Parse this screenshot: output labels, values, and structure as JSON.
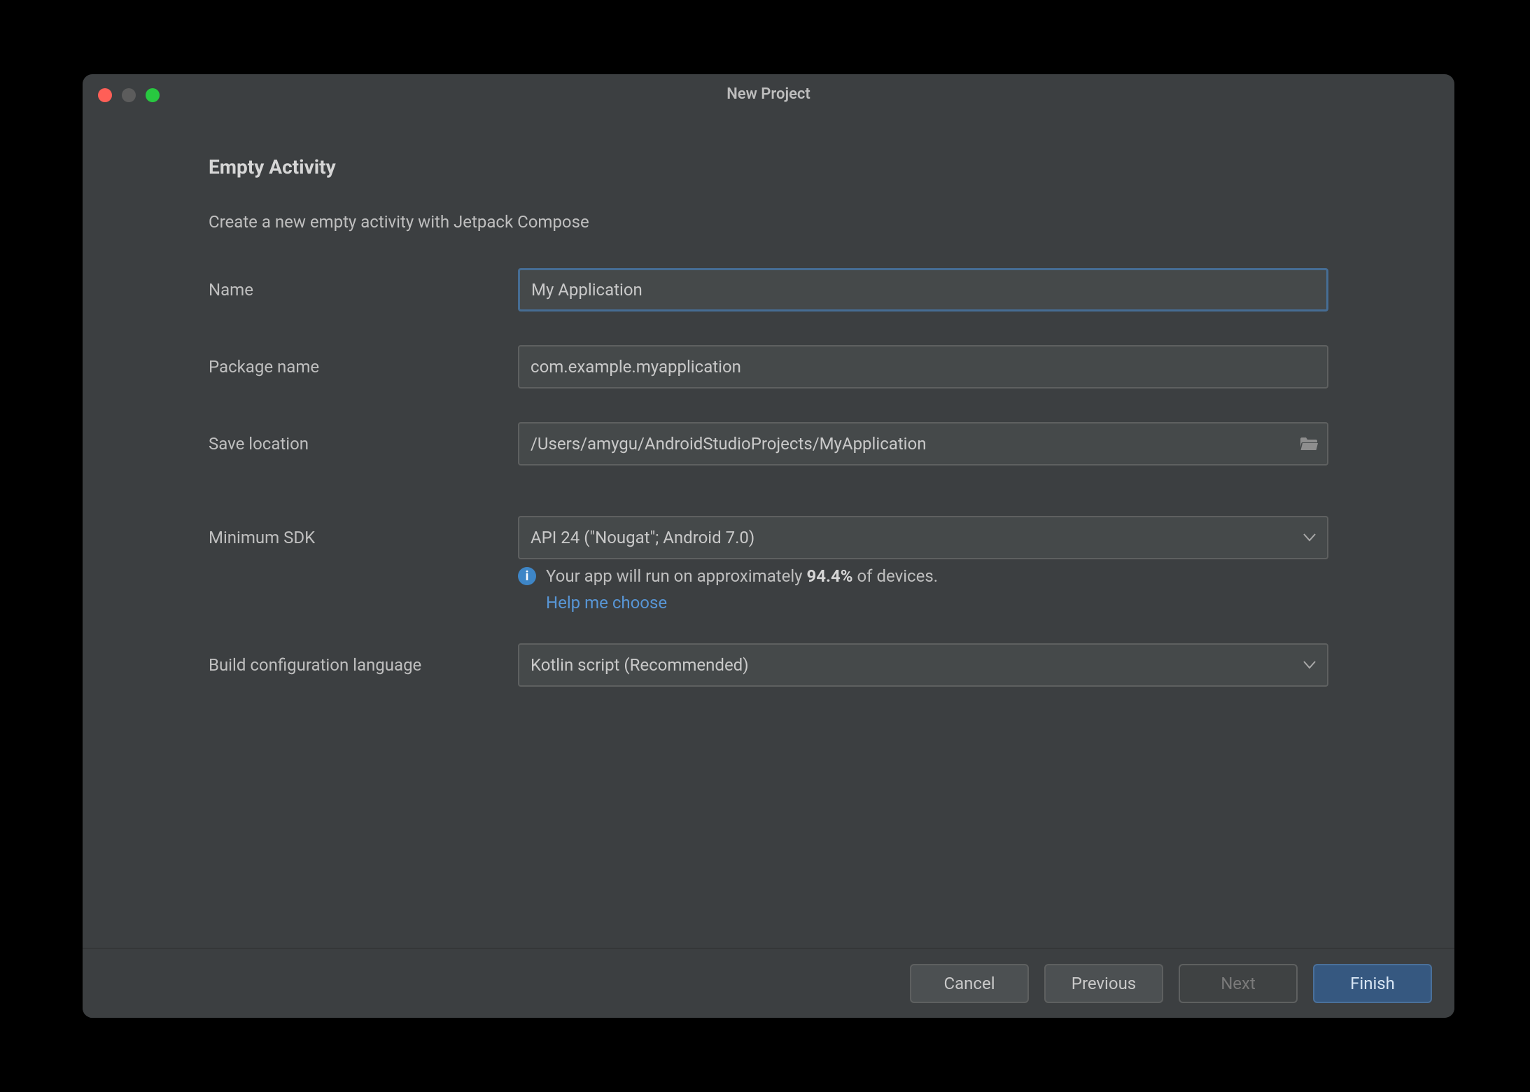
{
  "window": {
    "title": "New Project"
  },
  "page": {
    "heading": "Empty Activity",
    "subheading": "Create a new empty activity with Jetpack Compose"
  },
  "form": {
    "name": {
      "label": "Name",
      "value": "My Application"
    },
    "package": {
      "label": "Package name",
      "value": "com.example.myapplication"
    },
    "location": {
      "label": "Save location",
      "value": "/Users/amygu/AndroidStudioProjects/MyApplication"
    },
    "min_sdk": {
      "label": "Minimum SDK",
      "value": "API 24 (\"Nougat\"; Android 7.0)"
    },
    "build_lang": {
      "label": "Build configuration language",
      "value": "Kotlin script (Recommended)"
    }
  },
  "info": {
    "prefix": "Your app will run on approximately ",
    "percent": "94.4%",
    "suffix": " of devices.",
    "help": "Help me choose"
  },
  "buttons": {
    "cancel": "Cancel",
    "previous": "Previous",
    "next": "Next",
    "finish": "Finish"
  }
}
